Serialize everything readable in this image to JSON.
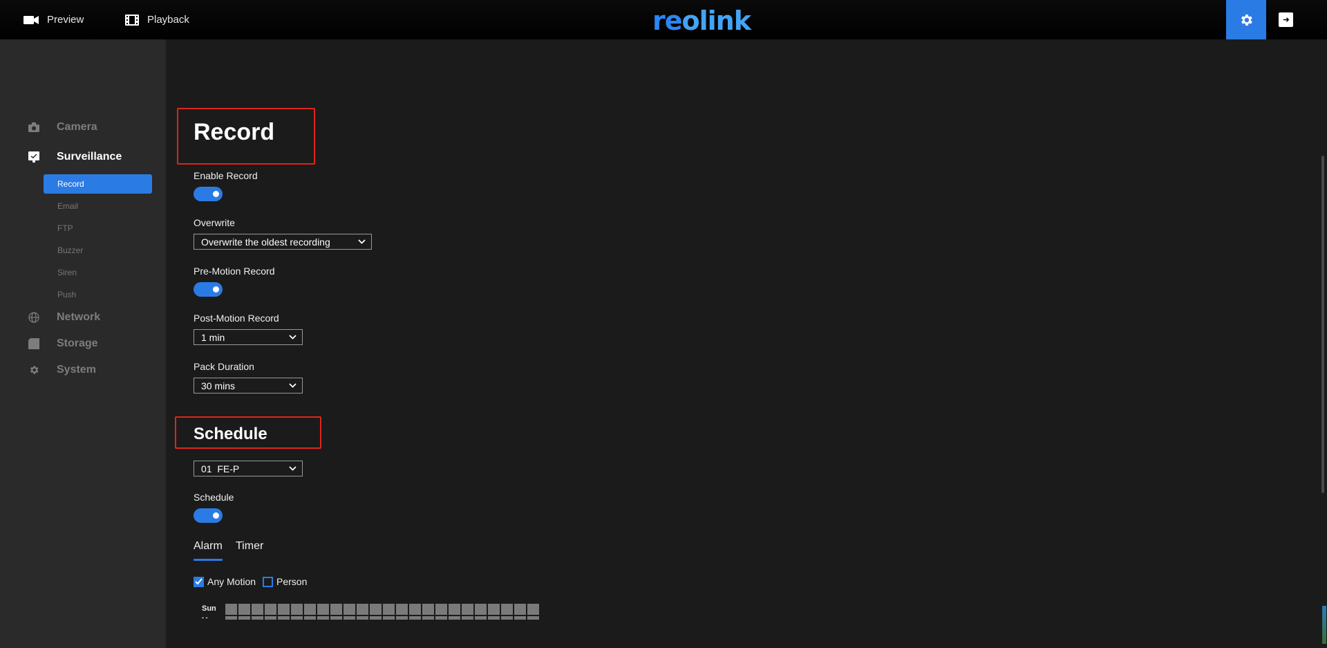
{
  "topbar": {
    "preview_label": "Preview",
    "playback_label": "Playback",
    "logo_text_a": "re",
    "logo_text_b": "o",
    "logo_text_c": "link"
  },
  "sidebar": {
    "groups": [
      {
        "label": "Camera",
        "icon": "camera-icon"
      },
      {
        "label": "Surveillance",
        "icon": "monitor-icon"
      },
      {
        "label": "Network",
        "icon": "globe-icon"
      },
      {
        "label": "Storage",
        "icon": "storage-icon"
      },
      {
        "label": "System",
        "icon": "gear-icon"
      }
    ],
    "subitems": [
      "Record",
      "Email",
      "FTP",
      "Buzzer",
      "Siren",
      "Push"
    ]
  },
  "record": {
    "title": "Record",
    "enable_label": "Enable Record",
    "enable_on": true,
    "overwrite_label": "Overwrite",
    "overwrite_value": "Overwrite the oldest recording",
    "pre_motion_label": "Pre-Motion Record",
    "pre_motion_on": true,
    "post_motion_label": "Post-Motion Record",
    "post_motion_value": "1 min",
    "pack_label": "Pack Duration",
    "pack_value": "30 mins"
  },
  "schedule": {
    "title": "Schedule",
    "channel_value": "01  FE-P",
    "schedule_label": "Schedule",
    "schedule_on": true,
    "tabs": [
      "Alarm",
      "Timer"
    ],
    "active_tab": "Alarm",
    "checks": [
      {
        "label": "Any Motion",
        "checked": true
      },
      {
        "label": "Person",
        "checked": false
      }
    ],
    "grid_day": "Sun",
    "grid_day_next": "- -"
  },
  "colors": {
    "accent": "#2b7be5",
    "highlight": "#e0251d",
    "background": "#1b1b1b",
    "sidebar": "#2a2a2a"
  }
}
